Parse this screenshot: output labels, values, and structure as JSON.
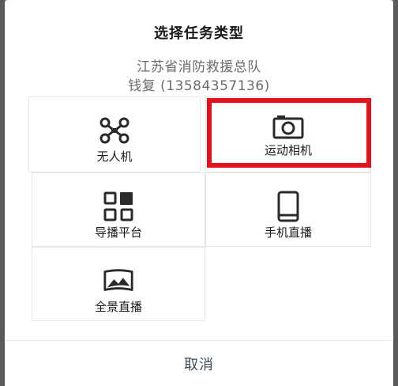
{
  "dialog": {
    "title": "选择任务类型",
    "org_line": "江苏省消防救援总队",
    "user_line": "钱复 (13584357136)"
  },
  "options": [
    {
      "label": "无人机",
      "icon": "drone-icon"
    },
    {
      "label": "运动相机",
      "icon": "action-camera-icon",
      "highlighted": true
    },
    {
      "label": "导播平台",
      "icon": "grid-layout-icon"
    },
    {
      "label": "手机直播",
      "icon": "mobile-phone-icon"
    },
    {
      "label": "全景直播",
      "icon": "panorama-icon"
    }
  ],
  "cancel_label": "取消",
  "colors": {
    "highlight": "#e3131b",
    "cancel_text": "#3a4a5a",
    "subtitle": "#6b6b6b"
  }
}
